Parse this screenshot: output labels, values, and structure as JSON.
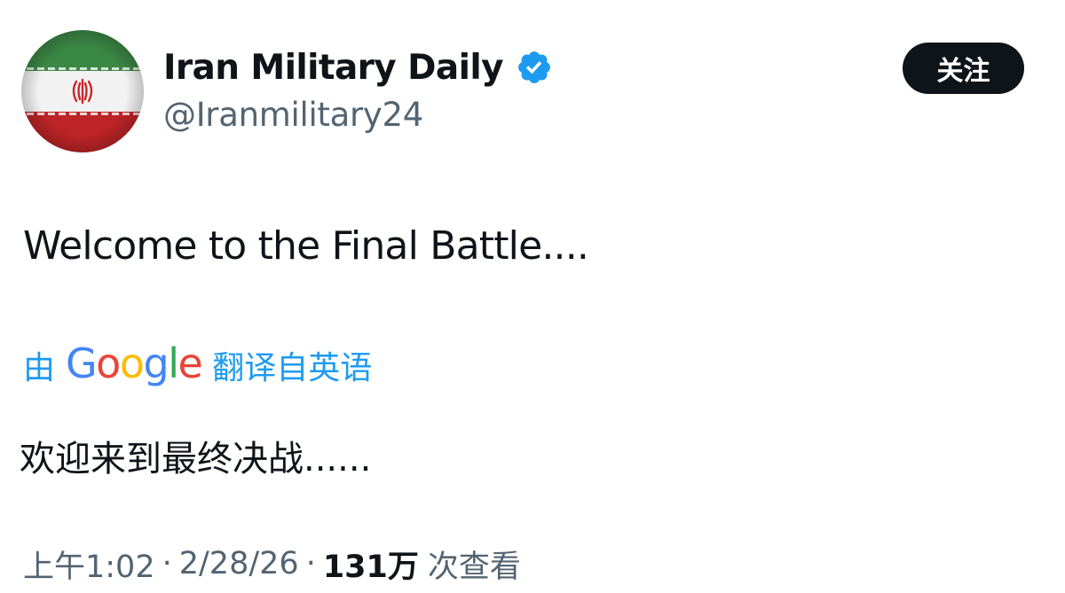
{
  "author": {
    "display_name": "Iran Military Daily",
    "handle": "@Iranmilitary24",
    "verified_icon": "verified-badge-icon",
    "avatar_icon": "iran-flag-avatar"
  },
  "actions": {
    "follow_label": "关注"
  },
  "tweet": {
    "text": "Welcome to the Final Battle...."
  },
  "translation": {
    "prefix": "由",
    "provider": "Google",
    "suffix": "翻译自英语",
    "translated_text": "欢迎来到最终决战......"
  },
  "meta": {
    "time": "上午1:02",
    "date": "2/28/26",
    "views_count": "131万",
    "views_label": "次查看",
    "separator": "·"
  },
  "colors": {
    "text_primary": "#0f1419",
    "text_secondary": "#536471",
    "link_blue": "#1d9bf0",
    "verified_blue": "#1d9bf0",
    "flag_green": "#239f40",
    "flag_red": "#da0000"
  }
}
